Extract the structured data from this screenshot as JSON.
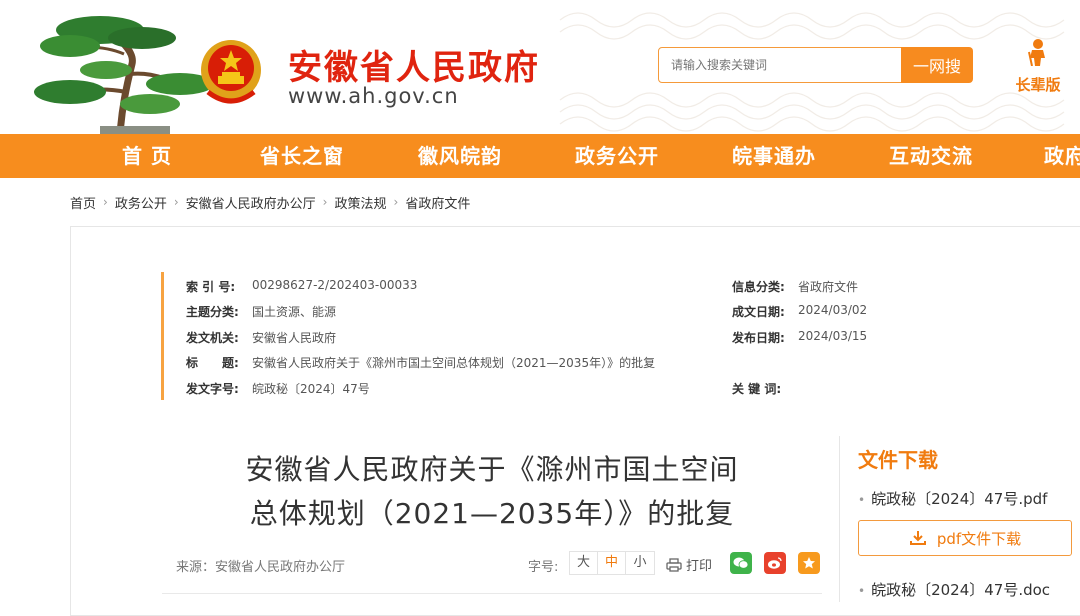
{
  "header": {
    "site_title": "安徽省人民政府",
    "site_url": "www.ah.gov.cn",
    "search_placeholder": "请输入搜索关键词",
    "search_button": "一网搜",
    "elder_mode": "长辈版"
  },
  "nav": {
    "items": [
      {
        "label": "首 页"
      },
      {
        "label": "省长之窗"
      },
      {
        "label": "徽风皖韵"
      },
      {
        "label": "政务公开"
      },
      {
        "label": "皖事通办"
      },
      {
        "label": "互动交流"
      },
      {
        "label": "政府"
      }
    ]
  },
  "breadcrumb": [
    "首页",
    "政务公开",
    "安徽省人民政府办公厅",
    "政策法规",
    "省政府文件"
  ],
  "meta": {
    "index_label": "索 引 号:",
    "index_value": "00298627-2/202403-00033",
    "category_label": "信息分类:",
    "category_value": "省政府文件",
    "topic_label": "主题分类:",
    "topic_value": "国土资源、能源",
    "created_label": "成文日期:",
    "created_value": "2024/03/02",
    "issuer_label": "发文机关:",
    "issuer_value": "安徽省人民政府",
    "published_label": "发布日期:",
    "published_value": "2024/03/15",
    "title_label": "标　　题:",
    "title_value": "安徽省人民政府关于《滁州市国土空间总体规划（2021—2035年）》的批复",
    "docno_label": "发文字号:",
    "docno_value": "皖政秘〔2024〕47号",
    "keywords_label": "关 键 词:",
    "keywords_value": ""
  },
  "article": {
    "title_line1": "安徽省人民政府关于《滁州市国土空间",
    "title_line2": "总体规划（2021—2035年）》的批复",
    "source": "来源：安徽省人民政府办公厅",
    "font_size_label": "字号:",
    "font_sizes": [
      "大",
      "中",
      "小"
    ],
    "print_label": "打印"
  },
  "download": {
    "title": "文件下载",
    "file1": "皖政秘〔2024〕47号.pdf",
    "file1_button": "pdf文件下载",
    "file2": "皖政秘〔2024〕47号.doc"
  },
  "colors": {
    "brand_orange": "#f78d1e",
    "title_red": "#e0240f",
    "accent_text": "#f07b0f"
  }
}
